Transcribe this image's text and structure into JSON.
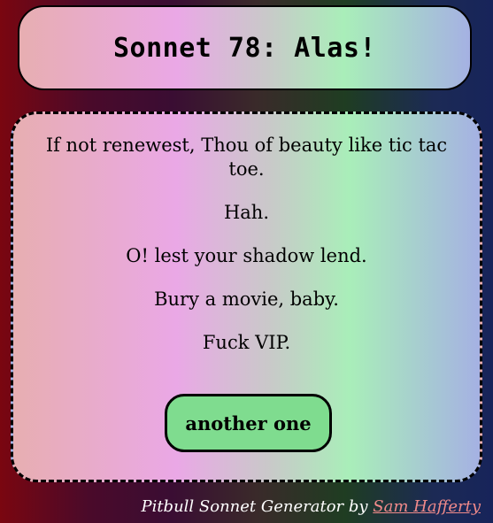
{
  "header": {
    "title": "Sonnet 78: Alas!"
  },
  "poem": {
    "lines": [
      "If not renewest, Thou of beauty like tic tac toe.",
      "Hah.",
      "O! lest your shadow lend.",
      "Bury a movie, baby.",
      "Fuck VIP."
    ]
  },
  "actions": {
    "another_label": "another one"
  },
  "footer": {
    "prefix": "Pitbull Sonnet Generator by ",
    "author_link": "Sam Hafferty"
  },
  "colors": {
    "card_gradient_start": "#e7aeb1",
    "card_gradient_pink": "#eaa8e6",
    "card_gradient_green": "#a9eeb9",
    "card_gradient_end": "#a5b1e3",
    "button_bg": "#7fdc8f",
    "link_color": "#f08a8a"
  }
}
